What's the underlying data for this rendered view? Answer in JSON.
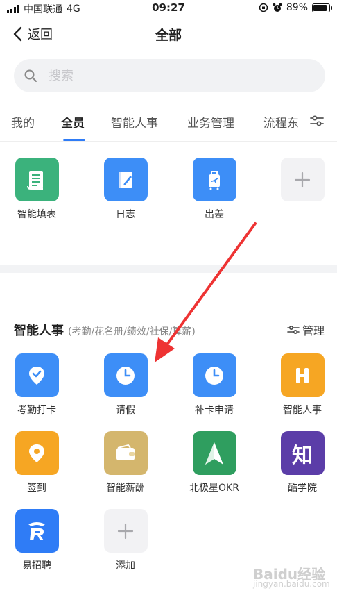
{
  "status_bar": {
    "carrier": "中国联通",
    "network": "4G",
    "time": "09:27",
    "battery": "89%"
  },
  "nav": {
    "back_label": "返回",
    "title": "全部"
  },
  "search": {
    "placeholder": "搜索"
  },
  "tabs": [
    {
      "label": "我的"
    },
    {
      "label": "全员"
    },
    {
      "label": "智能人事"
    },
    {
      "label": "业务管理"
    },
    {
      "label": "流程东"
    }
  ],
  "active_tab": "全员",
  "top_apps": [
    {
      "label": "智能填表",
      "icon": "form-icon",
      "color": "#3bb27c"
    },
    {
      "label": "日志",
      "icon": "journal-icon",
      "color": "#3d8ef7"
    },
    {
      "label": "出差",
      "icon": "luggage-icon",
      "color": "#3d8ef7"
    },
    {
      "label": "",
      "icon": "plus-icon",
      "color": "#f2f2f4"
    }
  ],
  "section": {
    "title": "智能人事",
    "subtitle": "(考勤/花名册/绩效/社保/算薪)",
    "manage_label": "管理"
  },
  "section_apps": [
    {
      "label": "考勤打卡",
      "icon": "location-check-icon",
      "color": "#3d8ef7"
    },
    {
      "label": "请假",
      "icon": "clock-icon",
      "color": "#3d8ef7"
    },
    {
      "label": "补卡申请",
      "icon": "clock-icon",
      "color": "#3d8ef7"
    },
    {
      "label": "智能人事",
      "icon": "h-logo-icon",
      "color": "#f6a623"
    },
    {
      "label": "签到",
      "icon": "location-pin-icon",
      "color": "#f6a623"
    },
    {
      "label": "智能薪酬",
      "icon": "wallet-icon",
      "color": "#d4b66d"
    },
    {
      "label": "北极星OKR",
      "icon": "north-arrow-icon",
      "color": "#2f9e5f"
    },
    {
      "label": "酷学院",
      "icon": "zhi-logo-icon",
      "color": "#5b3da8",
      "glyph": "知"
    },
    {
      "label": "易招聘",
      "icon": "r-logo-icon",
      "color": "#2f7cf6"
    },
    {
      "label": "添加",
      "icon": "plus-icon",
      "color": "#f2f2f4"
    }
  ],
  "watermark": {
    "brand": "Baidu经验",
    "url": "jingyan.baidu.com"
  }
}
